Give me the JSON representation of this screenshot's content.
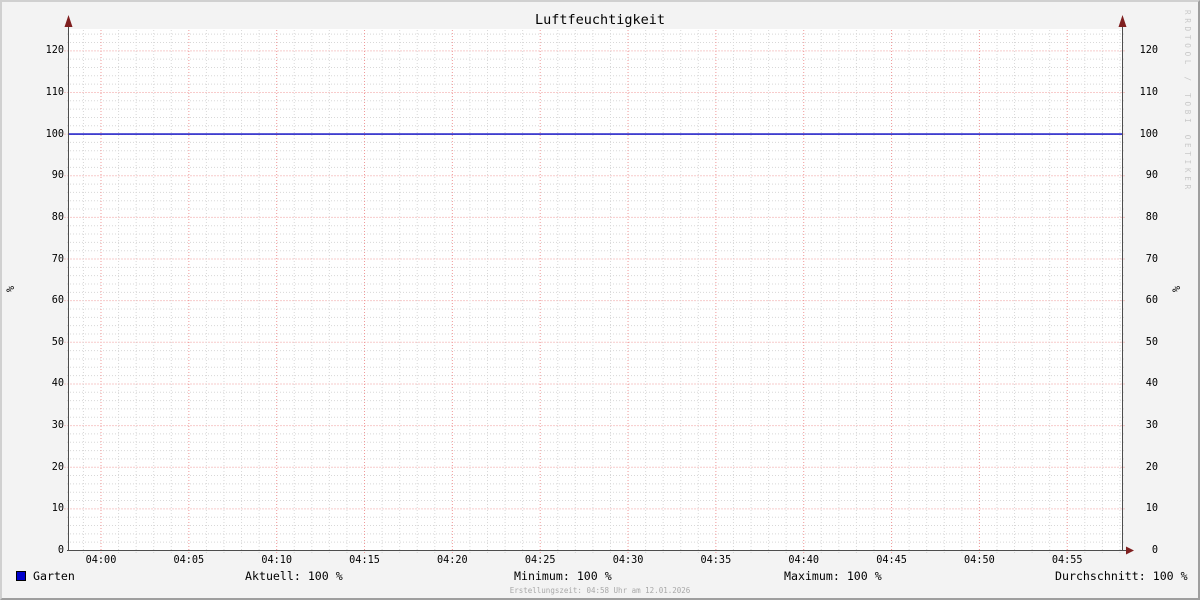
{
  "title": "Luftfeuchtigkeit",
  "watermark": "RRDTOOL / TOBI OETIKER",
  "y_axis": {
    "unit": "%"
  },
  "legend": {
    "series_label": "Garten",
    "series_color": "#0000cc",
    "stats": {
      "aktuell": "Aktuell: 100 %",
      "minimum": "Minimum: 100 %",
      "maximum": "Maximum: 100 %",
      "durchschnitt": "Durchschnitt: 100 %"
    }
  },
  "footer": "Erstellungszeit: 04:58 Uhr am 12.01.2026",
  "chart_data": {
    "type": "line",
    "title": "Luftfeuchtigkeit",
    "xlabel": "",
    "ylabel": "%",
    "x_ticks": [
      "04:00",
      "04:05",
      "04:10",
      "04:15",
      "04:20",
      "04:25",
      "04:30",
      "04:35",
      "04:40",
      "04:45",
      "04:50",
      "04:55"
    ],
    "x_tick_interval_minutes": 5,
    "x_minor_interval_minutes": 1,
    "y_ticks": [
      0,
      10,
      20,
      30,
      40,
      50,
      60,
      70,
      80,
      90,
      100,
      110,
      120
    ],
    "y_minor_interval": 2,
    "ylim": [
      0,
      125
    ],
    "grid": true,
    "legend_position": "bottom-left",
    "series": [
      {
        "name": "Garten",
        "color": "#0000cc",
        "constant_value": 100
      }
    ],
    "stats": {
      "aktuell": "100 %",
      "minimum": "100 %",
      "maximum": "100 %",
      "durchschnitt": "100 %"
    }
  },
  "colors": {
    "background": "#f3f3f3",
    "canvas": "#ffffff",
    "minor_grid": "#d8d8d8",
    "major_grid": "#f09898",
    "axis": "#4d4d4d",
    "arrow": "#7f1f1f",
    "line": "#0000c0"
  }
}
